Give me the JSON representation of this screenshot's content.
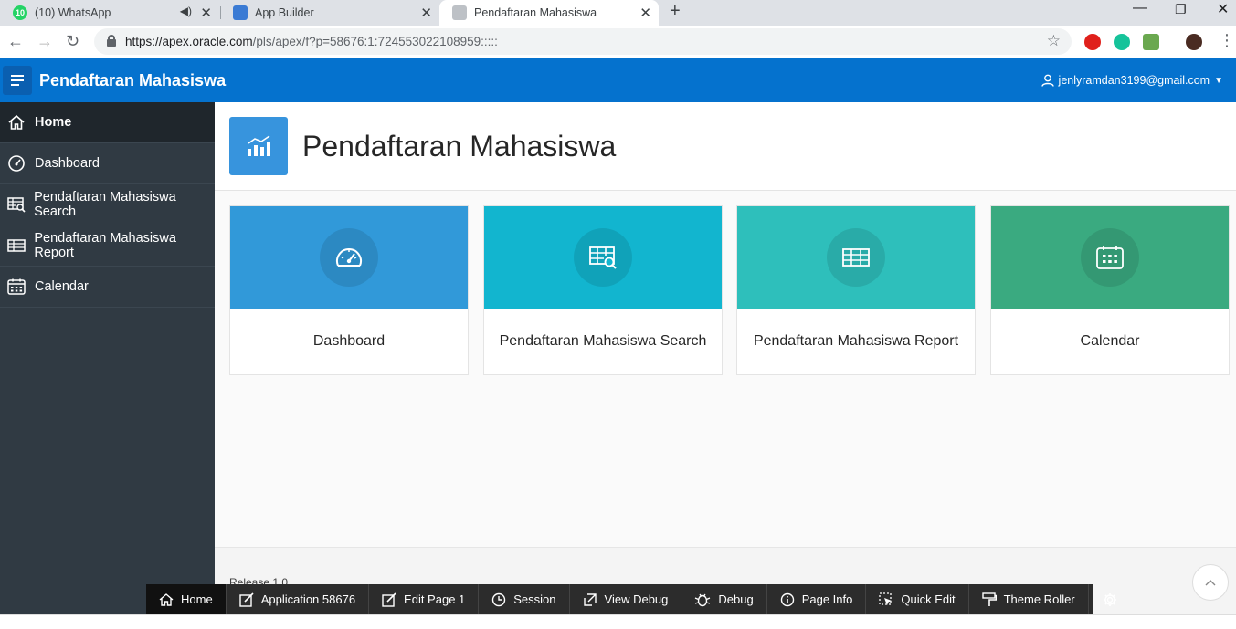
{
  "browser": {
    "tabs": [
      {
        "title": "(10) WhatsApp",
        "badge": "10",
        "color": "#25d366"
      },
      {
        "title": "App Builder",
        "color": "#3b7bd4"
      },
      {
        "title": "Pendaftaran Mahasiswa",
        "color": "#9aa0a6"
      }
    ],
    "url_host": "https://apex.oracle.com",
    "url_path": "/pls/apex/f?p=58676:1:724553022108959:::::"
  },
  "header": {
    "app_title": "Pendaftaran Mahasiswa",
    "user": "jenlyramdan3199@gmail.com"
  },
  "sidebar": {
    "items": [
      {
        "label": "Home",
        "icon": "home-icon"
      },
      {
        "label": "Dashboard",
        "icon": "dashboard-icon"
      },
      {
        "label": "Pendaftaran Mahasiswa Search",
        "icon": "table-search-icon"
      },
      {
        "label": "Pendaftaran Mahasiswa Report",
        "icon": "table-icon"
      },
      {
        "label": "Calendar",
        "icon": "calendar-icon"
      }
    ]
  },
  "hero": {
    "title": "Pendaftaran Mahasiswa",
    "icon": "chart-icon"
  },
  "cards": [
    {
      "label": "Dashboard",
      "color": "#3199d9",
      "icon": "dashboard-icon"
    },
    {
      "label": "Pendaftaran Mahasiswa Search",
      "color": "#12b5cf",
      "icon": "table-search-icon"
    },
    {
      "label": "Pendaftaran Mahasiswa Report",
      "color": "#2ebfbb",
      "icon": "table-icon"
    },
    {
      "label": "Calendar",
      "color": "#3aaa80",
      "icon": "calendar-icon"
    }
  ],
  "footer": {
    "release": "Release 1.0"
  },
  "devbar": {
    "home": "Home",
    "application": "Application 58676",
    "edit_page": "Edit Page 1",
    "session": "Session",
    "view_debug": "View Debug",
    "debug": "Debug",
    "page_info": "Page Info",
    "quick_edit": "Quick Edit",
    "theme_roller": "Theme Roller"
  }
}
